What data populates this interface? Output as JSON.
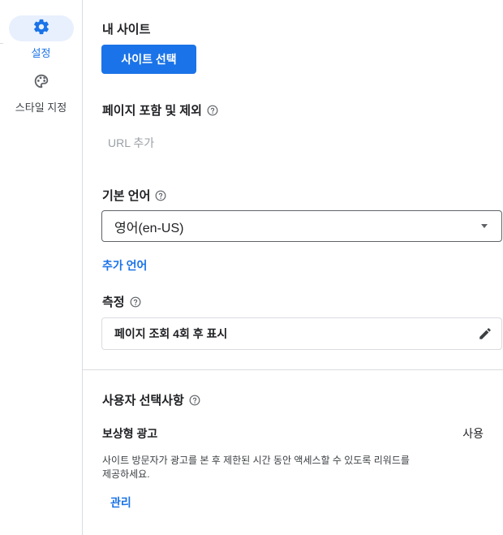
{
  "sidebar": {
    "items": [
      {
        "label": "설정",
        "icon": "gear-icon",
        "active": true
      },
      {
        "label": "스타일 지정",
        "icon": "palette-icon",
        "active": false
      }
    ]
  },
  "my_site": {
    "title": "내 사이트",
    "button": "사이트 선택"
  },
  "pages": {
    "title": "페이지 포함 및 제외",
    "placeholder": "URL 추가"
  },
  "language": {
    "title": "기본 언어",
    "selected": "영어(en-US)",
    "add_link": "추가 언어"
  },
  "measure": {
    "title": "측정",
    "value": "페이지 조회 4회 후 표시"
  },
  "user_choice": {
    "title": "사용자 선택사항",
    "reward_title": "보상형 광고",
    "status": "사용",
    "description": "사이트 방문자가 광고를 본 후 제한된 시간 동안 액세스할 수 있도록 리워드를 제공하세요.",
    "manage_link": "관리"
  },
  "colors": {
    "accent": "#1a73e8",
    "active_bg": "#e8f0fe",
    "border": "#dadce0"
  }
}
